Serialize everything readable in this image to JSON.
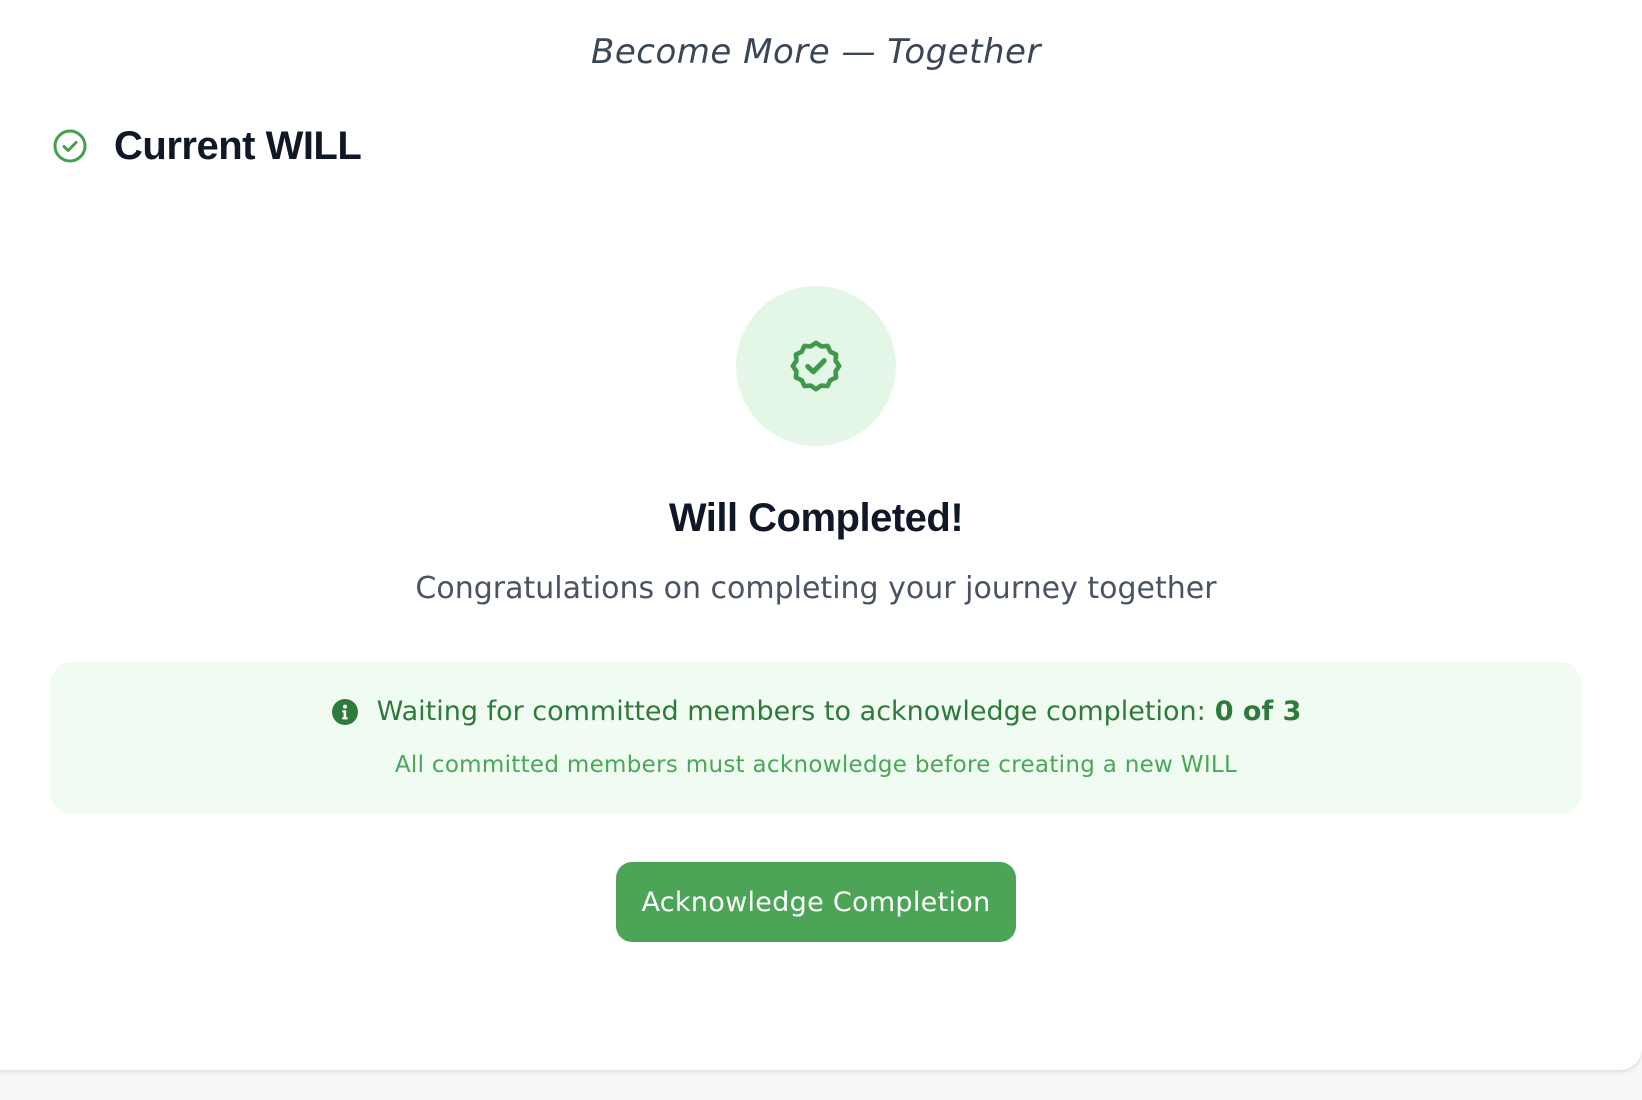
{
  "tagline": "Become More — Together",
  "header": {
    "title": "Current WILL",
    "icon": "check-circle-icon"
  },
  "status": {
    "icon": "badge-check-icon",
    "title": "Will Completed!",
    "subtitle": "Congratulations on completing your journey together"
  },
  "notice": {
    "icon": "info-icon",
    "message": "Waiting for committed members to acknowledge completion:",
    "count": "0 of 3",
    "acknowledged": 0,
    "total": 3,
    "sub": "All committed members must acknowledge before creating a new WILL"
  },
  "actions": {
    "acknowledge_label": "Acknowledge Completion"
  },
  "colors": {
    "accent": "#4ca556",
    "accent_dark": "#2e7a3b",
    "badge_bg": "#e4f7e7",
    "notice_bg": "#f0fbf2",
    "heading": "#101827",
    "text_muted": "#4a5363"
  }
}
